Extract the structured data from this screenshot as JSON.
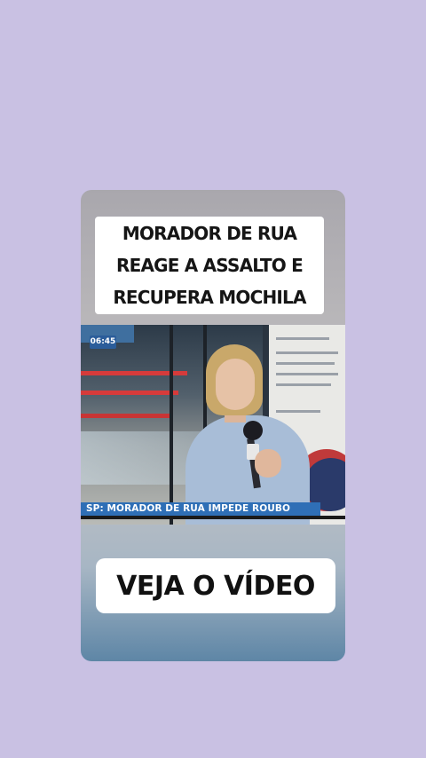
{
  "story": {
    "headline": "MORADOR DE RUA REAGE A ASSALTO E RECUPERA MOCHILA",
    "video": {
      "time_badge": "06:45",
      "caption": "SP: MORADOR DE RUA IMPEDE ROUBO"
    },
    "cta": "VEJA O VÍDEO"
  },
  "colors": {
    "page_background": "#c9c1e3",
    "lower_third": "#2f6fb6",
    "time_badge": "#2b5d9a"
  }
}
